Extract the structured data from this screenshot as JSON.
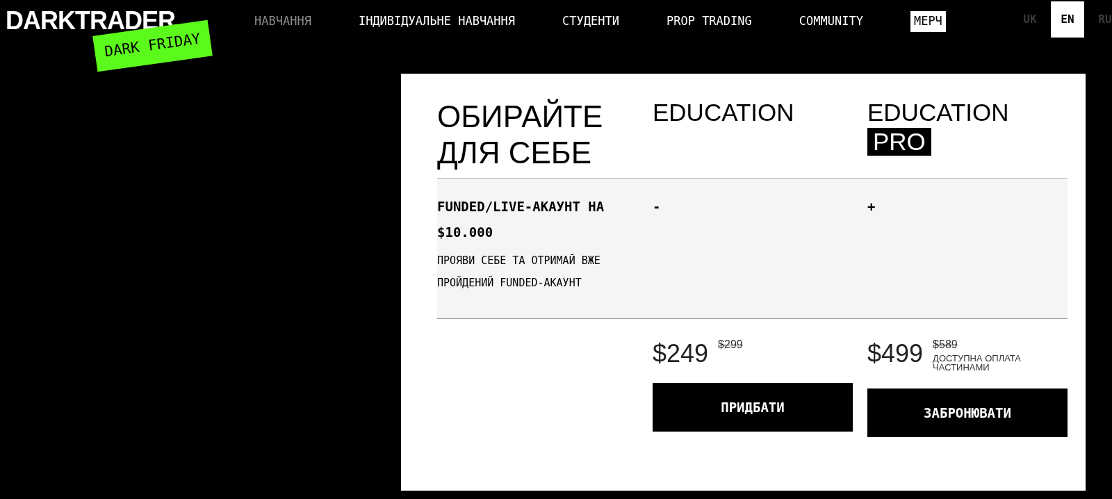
{
  "logo": {
    "text": "DARKTRADER",
    "badge": "DARK FRIDAY"
  },
  "nav": [
    {
      "label": "НАВЧАННЯ",
      "selected": true,
      "kind": "link"
    },
    {
      "label": "ІНДИВІДУАЛЬНЕ НАВЧАННЯ",
      "selected": false,
      "kind": "link"
    },
    {
      "label": "СТУДЕНТИ",
      "selected": false,
      "kind": "link"
    },
    {
      "label": "PROP TRADING",
      "selected": false,
      "kind": "link"
    },
    {
      "label": "COMMUNITY",
      "selected": false,
      "kind": "link"
    },
    {
      "label": "МЕРЧ",
      "selected": false,
      "kind": "boxed"
    }
  ],
  "languages": [
    {
      "label": "UK",
      "selected": false
    },
    {
      "label": "EN",
      "selected": true
    },
    {
      "label": "RU",
      "selected": false
    }
  ],
  "pricing": {
    "heading": [
      "ОБИРАЙТЕ",
      "ДЛЯ СЕБЕ"
    ],
    "plans": [
      {
        "name": "EDUCATION",
        "price": "$249",
        "old_price": "$299",
        "button": "ПРИДБАТИ"
      },
      {
        "name": "EDUCATION",
        "badge": "PRO",
        "price": "$499",
        "old_price": "$589",
        "note": "ДОСТУПНА ОПЛАТА ЧАСТИНАМИ",
        "button": "ЗАБРОНЮВАТИ"
      }
    ],
    "features": [
      {
        "title": "FUNDED/LIVE-АКАУНТ НА $10.000",
        "description": "ПРОЯВИ СЕБЕ ТА ОТРИМАЙ ВЖЕ ПРОЙДЕНИЙ FUNDED-АКАУНТ",
        "values": [
          "-",
          "+"
        ]
      }
    ]
  }
}
